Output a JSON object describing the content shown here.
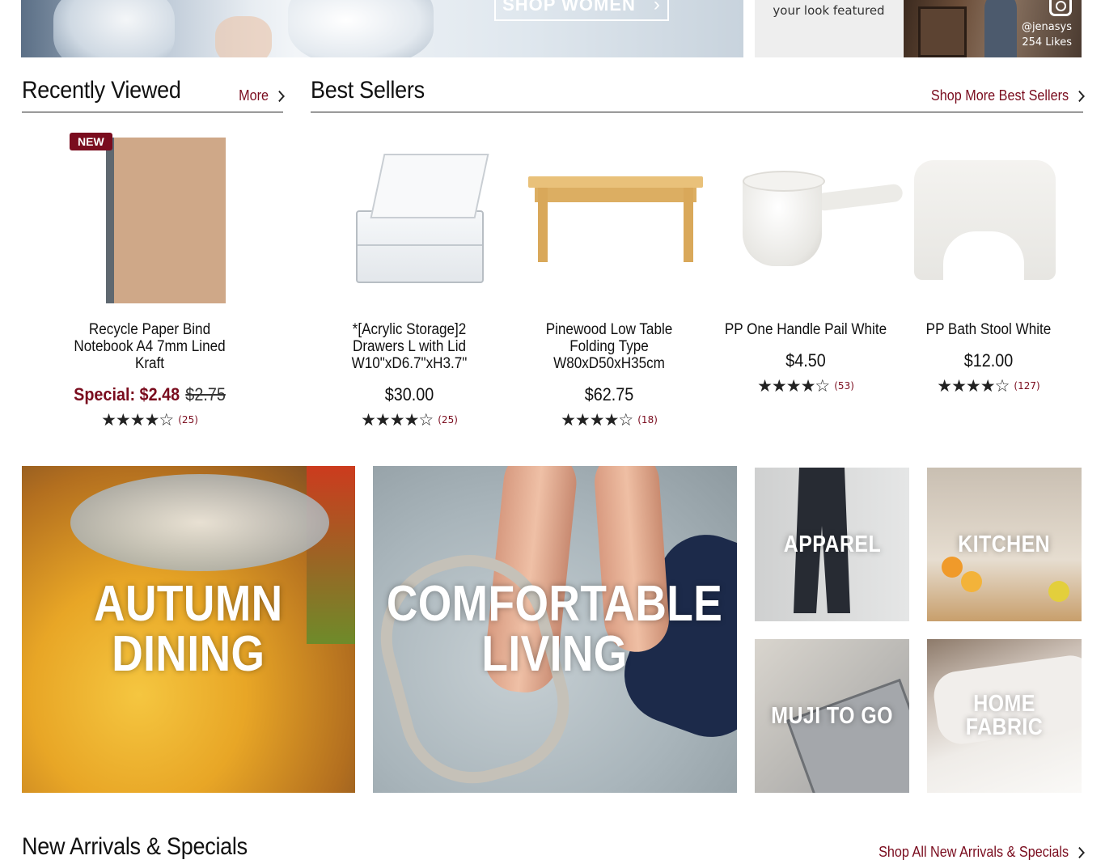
{
  "hero": {
    "cta_label": "SHOP WOMEN"
  },
  "instagram": {
    "caption": "your look featured",
    "handle": "@jenasys",
    "likes": "254 Likes",
    "icon": "instagram-icon"
  },
  "recently_viewed": {
    "title": "Recently Viewed",
    "more_label": "More",
    "items": [
      {
        "badge": "NEW",
        "name": "Recycle Paper Bind Notebook A4 7mm Lined Kraft",
        "special_price": "Special: $2.48",
        "original_price": "$2.75",
        "stars": "★★★★☆",
        "rating_count": "(25)"
      }
    ]
  },
  "best_sellers": {
    "title": "Best Sellers",
    "more_label": "Shop More Best Sellers",
    "items": [
      {
        "name": "*[Acrylic Storage]2 Drawers L with Lid W10\"xD6.7\"xH3.7\"",
        "price": "$30.00",
        "stars": "★★★★☆",
        "rating_count": "(25)"
      },
      {
        "name": "Pinewood Low Table Folding Type W80xD50xH35cm",
        "price": "$62.75",
        "stars": "★★★★☆",
        "rating_count": "(18)"
      },
      {
        "name": "PP One Handle Pail White",
        "price": "$4.50",
        "stars": "★★★★☆",
        "rating_count": "(53)"
      },
      {
        "name": "PP Bath Stool White",
        "price": "$12.00",
        "stars": "★★★★☆",
        "rating_count": "(127)"
      }
    ]
  },
  "categories": {
    "autumn_line1": "AUTUMN",
    "autumn_line2": "DINING",
    "comfort_line1": "COMFORTABLE",
    "comfort_line2": "LIVING",
    "apparel": "APPAREL",
    "kitchen": "KITCHEN",
    "muji_to_go": "MUJI TO GO",
    "home_fabric": "HOME FABRIC"
  },
  "new_arrivals": {
    "title": "New Arrivals & Specials",
    "more_label": "Shop All New Arrivals & Specials"
  },
  "colors": {
    "accent": "#7a0c1e",
    "text": "#111111",
    "divider": "#222222"
  }
}
